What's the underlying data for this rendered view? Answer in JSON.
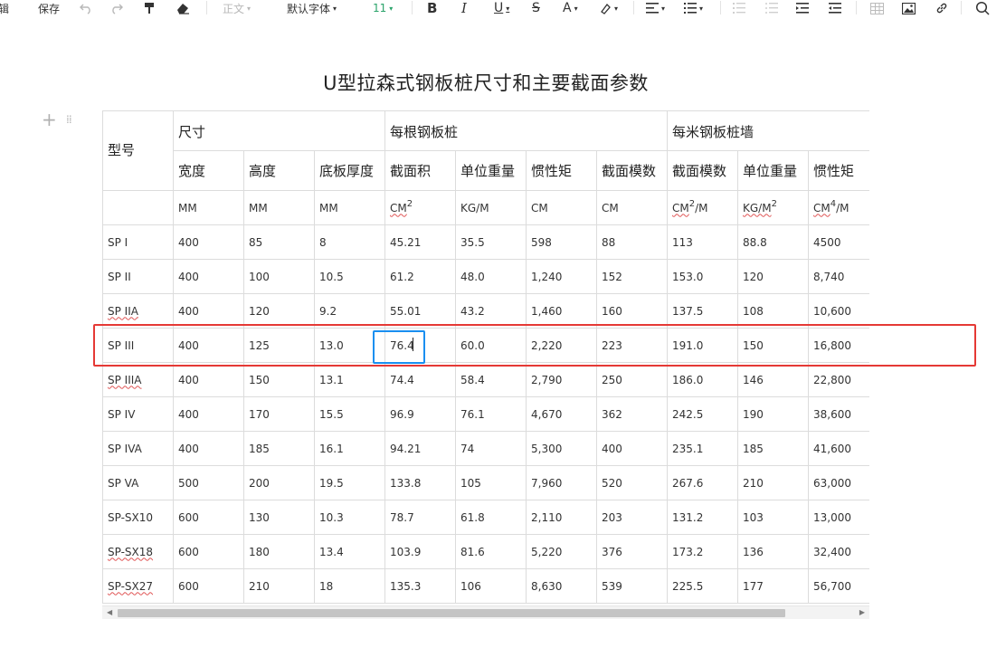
{
  "toolbar": {
    "edit_label": "辑",
    "save_label": "保存",
    "style_select": "正文",
    "font_select": "默认字体",
    "size_select": "11"
  },
  "document": {
    "title": "U型拉森式钢板桩尺寸和主要截面参数"
  },
  "table": {
    "header": {
      "model": "型号",
      "group_size": "尺寸",
      "group_per_pile": "每根钢板桩",
      "group_per_meter": "每米钢板桩墙",
      "cols": [
        "宽度",
        "高度",
        "底板厚度",
        "截面积",
        "单位重量",
        "惯性矩",
        "截面模数",
        "截面模数",
        "单位重量",
        "惯性矩"
      ]
    },
    "units": [
      "MM",
      "MM",
      "MM",
      "CM",
      "KG/M",
      "CM",
      "CM",
      "CM",
      "KG/M",
      "CM"
    ],
    "unit_parts": {
      "c4_sup": "2",
      "c8_sup": "2",
      "c8_tail": "/M",
      "c9_sup": "2",
      "c10_sup": "4",
      "c10_tail": "/M"
    },
    "rows": [
      [
        "SP I",
        "400",
        "85",
        "8",
        "45.21",
        "35.5",
        "598",
        "88",
        "113",
        "88.8",
        "4500"
      ],
      [
        "SP II",
        "400",
        "100",
        "10.5",
        "61.2",
        "48.0",
        "1,240",
        "152",
        "153.0",
        "120",
        "8,740"
      ],
      [
        "SP IIA",
        "400",
        "120",
        "9.2",
        "55.01",
        "43.2",
        "1,460",
        "160",
        "137.5",
        "108",
        "10,600"
      ],
      [
        "SP III",
        "400",
        "125",
        "13.0",
        "76.4",
        "60.0",
        "2,220",
        "223",
        "191.0",
        "150",
        "16,800"
      ],
      [
        "SP IIIA",
        "400",
        "150",
        "13.1",
        "74.4",
        "58.4",
        "2,790",
        "250",
        "186.0",
        "146",
        "22,800"
      ],
      [
        "SP IV",
        "400",
        "170",
        "15.5",
        "96.9",
        "76.1",
        "4,670",
        "362",
        "242.5",
        "190",
        "38,600"
      ],
      [
        "SP IVA",
        "400",
        "185",
        "16.1",
        "94.21",
        "74",
        "5,300",
        "400",
        "235.1",
        "185",
        "41,600"
      ],
      [
        "SP VA",
        "500",
        "200",
        "19.5",
        "133.8",
        "105",
        "7,960",
        "520",
        "267.6",
        "210",
        "63,000"
      ],
      [
        "SP-SX10",
        "600",
        "130",
        "10.3",
        "78.7",
        "61.8",
        "2,110",
        "203",
        "131.2",
        "103",
        "13,000"
      ],
      [
        "SP-SX18",
        "600",
        "180",
        "13.4",
        "103.9",
        "81.6",
        "5,220",
        "376",
        "173.2",
        "136",
        "32,400"
      ],
      [
        "SP-SX27",
        "600",
        "210",
        "18",
        "135.3",
        "106",
        "8,630",
        "539",
        "225.5",
        "177",
        "56,700"
      ]
    ]
  },
  "colors": {
    "highlight_row": "#e53935",
    "active_cell": "#1a8ff0"
  }
}
